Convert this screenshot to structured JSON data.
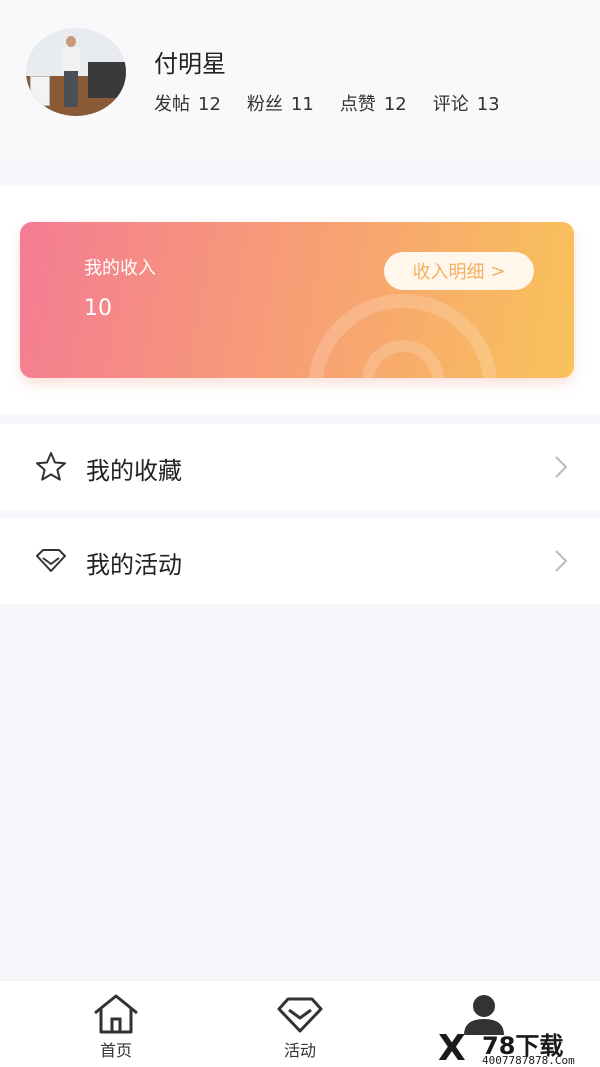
{
  "profile": {
    "name": "付明星",
    "stats": [
      {
        "label": "发帖",
        "value": "12"
      },
      {
        "label": "粉丝",
        "value": "11"
      },
      {
        "label": "点赞",
        "value": "12"
      },
      {
        "label": "评论",
        "value": "13"
      }
    ]
  },
  "income": {
    "label": "我的收入",
    "value": "10",
    "detail_label": "收入明细",
    "detail_arrow": ">"
  },
  "menu": {
    "favorites_label": "我的收藏",
    "activities_label": "我的活动"
  },
  "tabbar": {
    "home_label": "首页",
    "activity_label": "活动"
  },
  "watermark": {
    "mark": "X",
    "name": "78下载",
    "url": "4007787878.Com"
  },
  "colors": {
    "card_gradient_start": "#f47c93",
    "card_gradient_end": "#f8c25a",
    "detail_text": "#f4b15f"
  },
  "icons": {
    "favorites": "star-icon",
    "activities": "diamond-icon",
    "row_arrow": "chevron-right-icon",
    "home": "home-icon",
    "activity": "diamond-icon",
    "mine": "person-icon"
  }
}
